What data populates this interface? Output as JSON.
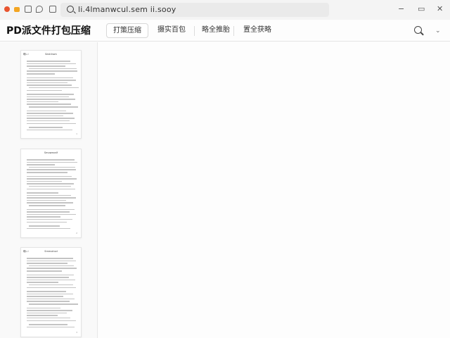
{
  "browser": {
    "url": "li.4lmanwcul.sem ii.sooy"
  },
  "app": {
    "title": "PD派文件打包压缩",
    "tabs": [
      {
        "label": "打策压缩",
        "active": true
      },
      {
        "label": "摄实百包",
        "active": false
      },
      {
        "label": "略全推胎",
        "active": false
      },
      {
        "label": "置全获略",
        "active": false
      }
    ]
  },
  "sidebar": {
    "pages": [
      {
        "label": "略L.I",
        "heading": "Sestilnwn",
        "page_number": "1"
      },
      {
        "label": "",
        "heading": "Smoweonlf",
        "page_number": "2"
      },
      {
        "label": "略L.I",
        "heading": "Smmolnsd",
        "page_number": "3"
      }
    ]
  },
  "colors": {
    "accent_red": "#e8542f",
    "accent_yellow": "#f3a522"
  }
}
